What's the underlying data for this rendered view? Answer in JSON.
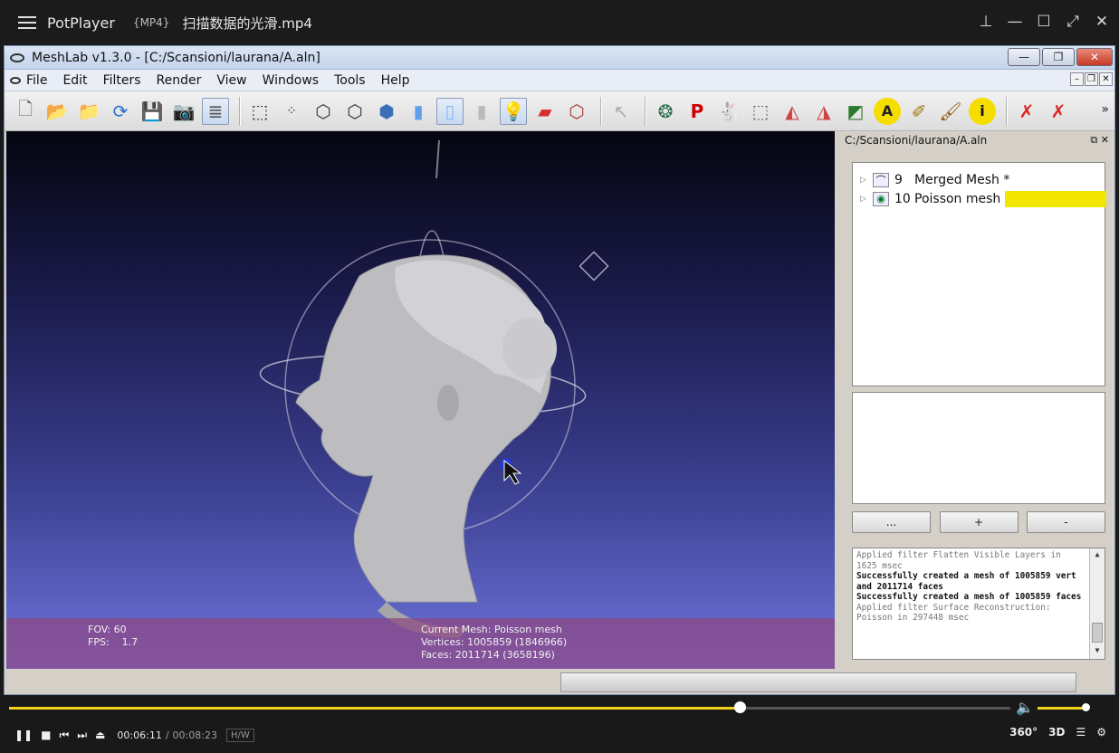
{
  "player": {
    "app_name": "PotPlayer",
    "format": "{MP4}",
    "file_name": "扫描数据的光滑.mp4",
    "current_time": "00:06:11",
    "separator": "/",
    "duration": "00:08:23",
    "hw_label": "H/W",
    "label_360": "360°",
    "label_3d": "3D",
    "progress_fraction": 0.73,
    "volume_fraction": 0.95
  },
  "meshlab": {
    "title": "MeshLab v1.3.0 - [C:/Scansioni/laurana/A.aln]",
    "menus": [
      "File",
      "Edit",
      "Filters",
      "Render",
      "View",
      "Windows",
      "Tools",
      "Help"
    ],
    "layer_panel_title": "C:/Scansioni/laurana/A.aln",
    "layers": [
      {
        "id": "9",
        "name": "Merged Mesh *"
      },
      {
        "id": "10",
        "name": "Poisson mesh *"
      }
    ],
    "buttons": {
      "more": "...",
      "add": "+",
      "remove": "-"
    },
    "log": [
      {
        "text": "Applied filter Flatten Visible Layers in 1625 msec",
        "style": "muted"
      },
      {
        "text": "Successfully created a mesh of 1005859 vert and 2011714 faces",
        "style": "bold"
      },
      {
        "text": "Successfully created a mesh of 1005859 faces",
        "style": "bold"
      },
      {
        "text": "Applied filter Surface Reconstruction: Poisson in 297448 msec",
        "style": "muted"
      }
    ],
    "viewport_info": {
      "fov": "FOV: 60",
      "fps": "FPS:    1.7",
      "current_mesh": "Current Mesh: Poisson mesh",
      "vertices": "Vertices: 1005859 (1846966)",
      "faces": "Faces: 2011714 (3658196)"
    }
  }
}
